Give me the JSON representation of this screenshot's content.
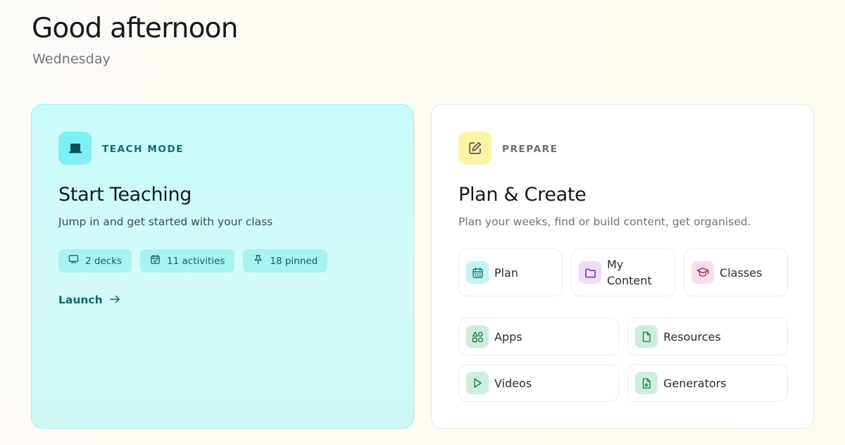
{
  "greeting": "Good afternoon",
  "day": "Wednesday",
  "teach_card": {
    "mode_label": "TEACH MODE",
    "icon": "presentation-board-icon",
    "title": "Start Teaching",
    "subtitle": "Jump in and get started with your class",
    "chips": [
      {
        "icon": "slides-icon",
        "label": "2 decks"
      },
      {
        "icon": "calendar-check-icon",
        "label": "11 activities"
      },
      {
        "icon": "pin-icon",
        "label": "18 pinned"
      }
    ],
    "launch_label": "Launch",
    "accent": "#10676f"
  },
  "prepare_card": {
    "mode_label": "PREPARE",
    "icon": "edit-icon",
    "title": "Plan & Create",
    "subtitle": "Plan your weeks, find or build content, get organised.",
    "tiles": [
      {
        "label": "Plan",
        "icon": "calendar-icon"
      },
      {
        "label": "My\nContent",
        "icon": "folder-icon"
      },
      {
        "label": "Classes",
        "icon": "graduation-cap-icon"
      },
      {
        "label": "Apps",
        "icon": "apps-shapes-icon"
      },
      {
        "label": "Resources",
        "icon": "file-icon"
      },
      {
        "label": "Videos",
        "icon": "play-icon"
      },
      {
        "label": "Generators",
        "icon": "file-download-icon"
      }
    ]
  }
}
